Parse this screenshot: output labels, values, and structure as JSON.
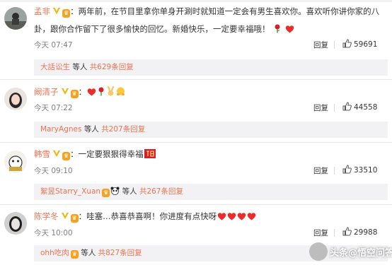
{
  "comments": [
    {
      "username": "孟非",
      "text": "：两年前，在节目里拿你单身开涮时就知道一定会有男生喜欢你。喜欢听你讲你家的八卦，跟你合作留下了很多愉快的回忆。新婚快乐，一定要幸福哦！",
      "text_line1": "：两年前，在节目里拿你单身开涮时就知道一定会有男生喜欢你。喜欢听你讲你家的八",
      "text_line2": "卦，跟你合作留下了很多愉快的回忆。新婚快乐，一定要幸福哦！",
      "time": "今天 07:47",
      "reply_label": "回复",
      "likes": "59691",
      "replies": {
        "name": "大話讼生",
        "mid": "等人",
        "count": "共629条回复"
      }
    },
    {
      "username": "阚清子",
      "text": "：",
      "time": "今天 07:22",
      "reply_label": "回复",
      "likes": "44558",
      "replies": {
        "name": "MaryAgnes",
        "mid": "等人",
        "count": "共207条回复"
      }
    },
    {
      "username": "韩雪",
      "text": "：一定要狠狠得幸福",
      "time": "今天 09:10",
      "reply_label": "回复",
      "likes": "33510",
      "replies": {
        "name": "絮昱Starry_Xuan",
        "mid": "等人",
        "count": "共267条回复"
      }
    },
    {
      "username": "陈学冬",
      "text": "：哇塞…恭喜恭喜啊！你进度有点快呀",
      "time": "今天 10:00",
      "reply_label": "回复",
      "likes": "29988",
      "replies": {
        "name": "ohh吃肉",
        "mid": "等人",
        "count": "共827条回复"
      }
    }
  ],
  "watermark": "头条@悟空问答",
  "colors": {
    "accent": "#eb7350",
    "meta": "#808080",
    "reply_bg": "#f2f2f5"
  },
  "icons": [
    "v-badge-icon",
    "vip-badge-icon",
    "thumb-up-icon",
    "rose-icon",
    "heart-icon",
    "victory-hand-icon",
    "panda-icon",
    "fu-character-icon"
  ]
}
